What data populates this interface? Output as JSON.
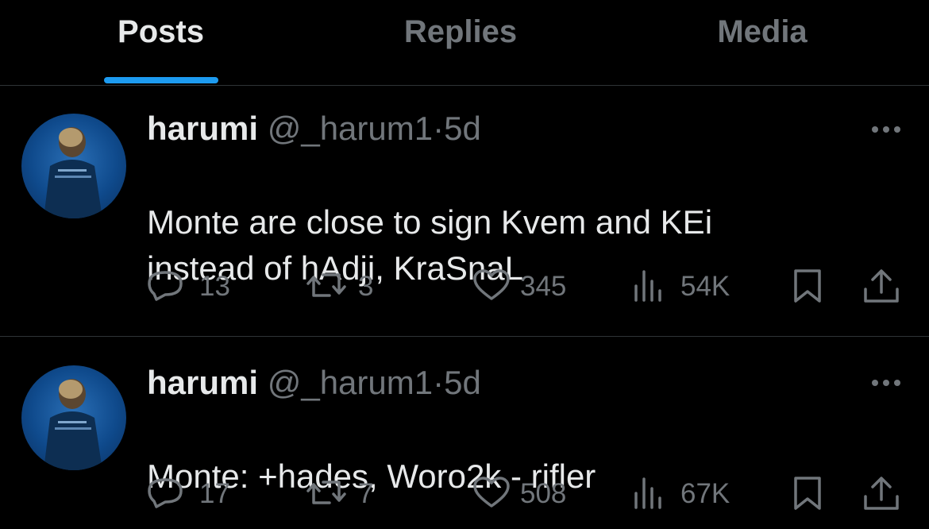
{
  "tabs": [
    {
      "label": "Posts",
      "active": true
    },
    {
      "label": "Replies",
      "active": false
    },
    {
      "label": "Media",
      "active": false
    }
  ],
  "colors": {
    "accent": "#1d9bf0",
    "text": "#e7e9ea",
    "muted": "#71767b",
    "divider": "#2f3336",
    "background": "#000000"
  },
  "posts": [
    {
      "name": "harumi",
      "handle": "@_harum1",
      "separator": "·",
      "time": "5d",
      "flag_icon": "ukraine-flag-icon",
      "lines": [
        "Monte are close to sign Kvem and KEi",
        "instead of hAdji, KraSnaL"
      ],
      "replies": "13",
      "reposts": "3",
      "likes": "345",
      "views": "54K"
    },
    {
      "name": "harumi",
      "handle": "@_harum1",
      "separator": "·",
      "time": "5d",
      "flag_icon": "ukraine-flag-icon",
      "lines": [
        "Monte: +hades, Woro2k - rifler"
      ],
      "replies": "17",
      "reposts": "7",
      "likes": "508",
      "views": "67K"
    }
  ]
}
